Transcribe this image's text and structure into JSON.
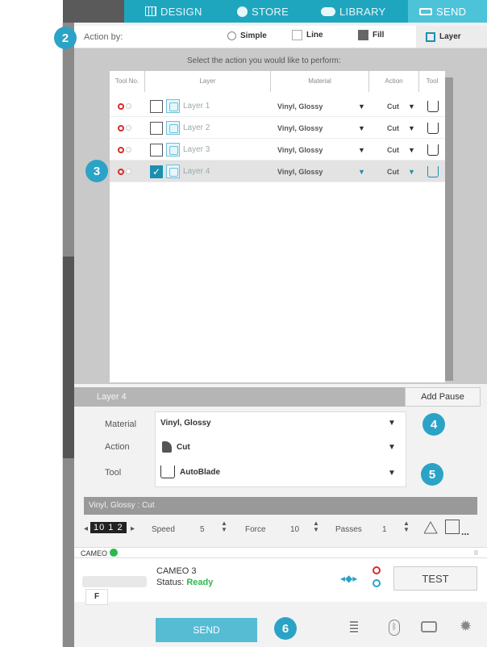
{
  "nav": {
    "tabs": [
      {
        "label": "DESIGN",
        "icon": "grid-icon"
      },
      {
        "label": "STORE",
        "icon": "store-icon"
      },
      {
        "label": "LIBRARY",
        "icon": "cloud-icon"
      },
      {
        "label": "SEND",
        "icon": "cutter-icon",
        "active": true
      }
    ]
  },
  "action_by": {
    "label": "Action by:",
    "options": [
      "Simple",
      "Line",
      "Fill",
      "Layer"
    ],
    "selected": "Layer"
  },
  "instruction": "Select the action you would like to perform:",
  "table": {
    "headers": [
      "Tool No.",
      "Layer",
      "Material",
      "Action",
      "Tool"
    ],
    "rows": [
      {
        "layer": "Layer 1",
        "material": "Vinyl, Glossy",
        "action": "Cut",
        "checked": false,
        "selected": false
      },
      {
        "layer": "Layer 2",
        "material": "Vinyl, Glossy",
        "action": "Cut",
        "checked": false,
        "selected": false
      },
      {
        "layer": "Layer 3",
        "material": "Vinyl, Glossy",
        "action": "Cut",
        "checked": false,
        "selected": false
      },
      {
        "layer": "Layer 4",
        "material": "Vinyl, Glossy",
        "action": "Cut",
        "checked": true,
        "selected": true
      }
    ]
  },
  "layer_panel": {
    "title": "Layer 4",
    "add_pause": "Add Pause"
  },
  "properties": {
    "material_label": "Material",
    "material_value": "Vinyl, Glossy",
    "action_label": "Action",
    "action_value": "Cut",
    "tool_label": "Tool",
    "tool_value": "AutoBlade"
  },
  "preset": {
    "title": "Vinyl, Glossy : Cut",
    "blade_digits": "10 1 2",
    "speed_label": "Speed",
    "speed": "5",
    "force_label": "Force",
    "force": "10",
    "passes_label": "Passes",
    "passes": "1",
    "more": "..."
  },
  "device": {
    "bar_label": "CAMEO",
    "model": "CAMEO 3",
    "status_label": "Status:",
    "status_value": "Ready",
    "test_label": "TEST",
    "printer_label": "F"
  },
  "send_label": "SEND",
  "callouts": [
    "2",
    "3",
    "4",
    "5",
    "6"
  ],
  "colors": {
    "teal": "#1fa6bf",
    "badge": "#2ba3c6",
    "ready": "#2db84d",
    "red": "#d82b2b"
  }
}
